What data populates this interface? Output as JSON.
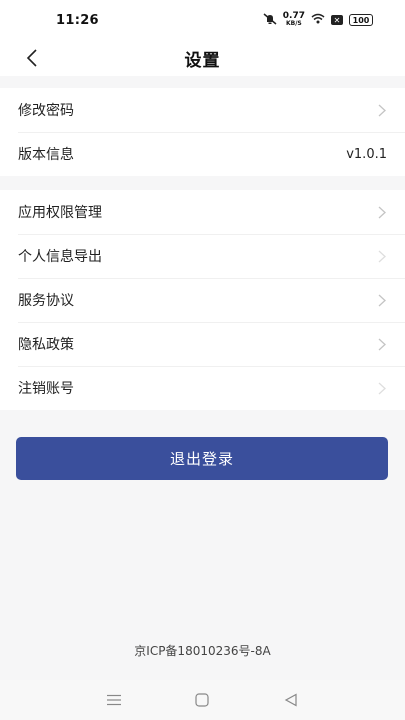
{
  "status_bar": {
    "time": "11:26",
    "speed_value": "0.77",
    "speed_unit": "KB/S",
    "battery": "100"
  },
  "header": {
    "title": "设置"
  },
  "group1": [
    {
      "label": "修改密码",
      "value": ""
    },
    {
      "label": "版本信息",
      "value": "v1.0.1"
    }
  ],
  "group2": [
    {
      "label": "应用权限管理"
    },
    {
      "label": "个人信息导出"
    },
    {
      "label": "服务协议"
    },
    {
      "label": "隐私政策"
    },
    {
      "label": "注销账号"
    }
  ],
  "logout": {
    "label": "退出登录"
  },
  "footer": {
    "icp": "京ICP备18010236号-8A"
  },
  "colors": {
    "accent": "#3a4f9c",
    "background": "#f6f6f7"
  },
  "icons": [
    "back-icon",
    "chevron-right-icon",
    "menu-icon",
    "home-icon",
    "back-triangle-icon",
    "mute-bell-icon",
    "wifi-icon"
  ]
}
